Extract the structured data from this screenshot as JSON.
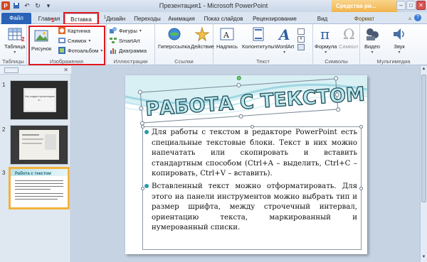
{
  "window": {
    "title": "Презентация1 - Microsoft PowerPoint",
    "context_tab_title": "Средства ри..."
  },
  "tabs": [
    {
      "label": "Файл"
    },
    {
      "label": "Главная"
    },
    {
      "label": "Вставка"
    },
    {
      "label": "Дизайн"
    },
    {
      "label": "Переходы"
    },
    {
      "label": "Анимация"
    },
    {
      "label": "Показ слайдов"
    },
    {
      "label": "Рецензирование"
    },
    {
      "label": "Вид"
    },
    {
      "label": "Формат"
    }
  ],
  "ribbon": {
    "groups": {
      "tables": "Таблицы",
      "images": "Изображения",
      "illustrations": "Иллюстрации",
      "links": "Ссылки",
      "text": "Текст",
      "symbols": "Символы",
      "multimedia": "Мультимедиа"
    },
    "buttons": {
      "table": "Таблица",
      "picture": "Рисунок",
      "clipart": "Картинка",
      "screenshot": "Снимок",
      "photoalbum": "Фотоальбом",
      "shapes": "Фигуры",
      "smartart": "SmartArt",
      "chart": "Диаграмма",
      "hyperlink": "Гиперссылка",
      "action": "Действие",
      "textbox": "Надпись",
      "headerfooter": "Колонтитулы",
      "wordart": "WordArt",
      "formula": "Формула",
      "symbol": "Символ",
      "video": "Видео",
      "audio": "Звук"
    }
  },
  "slides_pane": {
    "numbers": [
      "1",
      "2",
      "3"
    ],
    "thumb1_title": "Как создать презентацию в...",
    "thumb3_title": "Работа с текстом"
  },
  "slide": {
    "title": "РАБОТА С ТЕКСТОМ",
    "paragraphs": [
      "Для работы с текстом в редакторе PowerPoint есть специальные текстовые блоки. Текст в них можно напечатать или скопировать и вставить стандартным способом (Ctrl+A – выделить, Ctrl+C – копировать, Ctrl+V – вставить).",
      "Вставленный текст можно отформатировать. Для этого на панели инструментов можно выбрать тип и размер шрифта, между строчечный интервал, ориентацию текста, маркированный и нумерованный списки."
    ]
  },
  "colors": {
    "accent_red": "#e0181b",
    "file_tab": "#2a63b6",
    "slide_teal": "#2e98ad",
    "selected_thumb": "#f2b33d"
  }
}
